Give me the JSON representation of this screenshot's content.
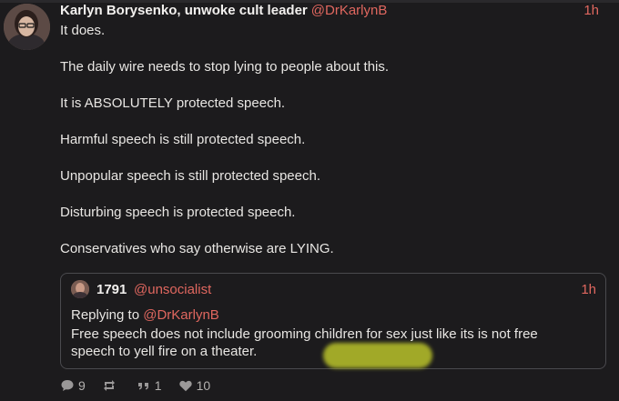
{
  "post": {
    "author_name": "Karlyn Borysenko, unwoke cult leader",
    "author_handle": "@DrKarlynB",
    "time": "1h",
    "paragraphs": [
      "It does.",
      "The daily wire needs to stop lying to people about this.",
      "It is ABSOLUTELY protected speech.",
      "Harmful speech is still protected speech.",
      "Unpopular speech is still protected speech.",
      "Disturbing speech is protected speech.",
      "Conservatives who say otherwise are LYING."
    ]
  },
  "quote": {
    "author_name": "1791",
    "author_handle": "@unsocialist",
    "time": "1h",
    "replying_prefix": "Replying to",
    "replying_handle": "@DrKarlynB",
    "text": "Free speech does not include grooming children for sex just like its is not free speech to yell fire on a theater."
  },
  "actions": {
    "replies": "9",
    "reposts": "",
    "quotes": "1",
    "likes": "10"
  },
  "colors": {
    "background": "#1c1b1d",
    "accent": "#e0675f",
    "highlight": "#b9c22a"
  },
  "icons": {
    "reply": "speech-bubble-icon",
    "repost": "repost-arrows-icon",
    "quote": "quote-marks-icon",
    "like": "heart-icon"
  }
}
